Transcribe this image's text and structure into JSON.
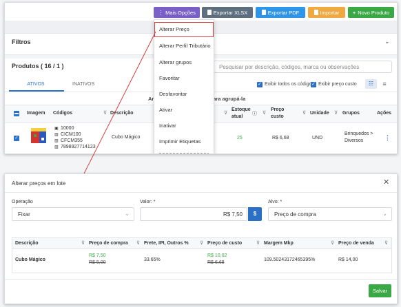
{
  "toolbar": {
    "more_options_label": "Mais Opções",
    "export_xlsx_label": "Exportar XLSX",
    "export_pdf_label": "Exportar PDF",
    "import_label": "Importar",
    "new_product_label": "Novo Produto"
  },
  "filters": {
    "title": "Filtros"
  },
  "products": {
    "title": "Produtos ( 16 / 1 )",
    "search_placeholder": "Pesquisar por descrição, códigos, marca ou observações",
    "tabs": [
      "ATIVOS",
      "INATIVOS"
    ],
    "show_all_codes_label": "Exibir todos os códigos",
    "show_cost_price_label": "Exibir preço custo",
    "group_hint": "Arraste uma coluna aqui para agrupá-la",
    "columns": {
      "image": "Imagem",
      "codes": "Códigos",
      "description": "Descrição",
      "stock_line1": "Estoque",
      "stock_line2": "atual",
      "price_line1": "Preço",
      "price_line2": "custo",
      "unit": "Unidade",
      "groups": "Grupos",
      "actions": "Ações"
    },
    "row": {
      "codes": [
        "10000",
        "CICM100",
        "CFCM355",
        "7898927714123"
      ],
      "description": "Cubo Mágico",
      "stock": "25",
      "cost_price": "R$ 6,68",
      "unit": "UND",
      "group_line1": "Brinquedos >",
      "group_line2": "Diversos"
    }
  },
  "dropdown": {
    "items": [
      "Alterar Preço",
      "Alterar Perfil Tributário",
      "Alterar grupos",
      "Favoritar",
      "Desfavoritar",
      "Ativar",
      "Inativar",
      "Imprimir Etiquetas"
    ]
  },
  "modal": {
    "title": "Alterar preços em lote",
    "operation_label": "Operação",
    "operation_value": "Fixar",
    "value_label": "Valor: *",
    "value_value": "R$ 7,50",
    "value_suffix": "$",
    "target_label": "Alvo: *",
    "target_value": "Preço de compra",
    "columns": {
      "description": "Descrição",
      "purchase_price": "Preço de compra",
      "freight": "Frete, IPI, Outros %",
      "cost_price": "Preço de custo",
      "margin": "Margem Mkp",
      "sale_price": "Preço de venda"
    },
    "row": {
      "description": "Cubo Mágico",
      "purchase_new": "R$ 7,50",
      "purchase_old": "R$ 5,00",
      "freight": "33.65%",
      "cost_new": "R$ 10,02",
      "cost_old": "R$ 6,68",
      "margin": "109.50243172465395%",
      "sale_price": "R$ 14,00"
    },
    "save_label": "Salvar"
  },
  "colors": {
    "purple": "#7b5fc9",
    "slate": "#5e6f7f",
    "blue": "#2f95e8",
    "orange": "#f0a940",
    "green": "#3aa845",
    "accent_blue": "#2b6fc7",
    "highlight_red": "#d63b3b"
  }
}
